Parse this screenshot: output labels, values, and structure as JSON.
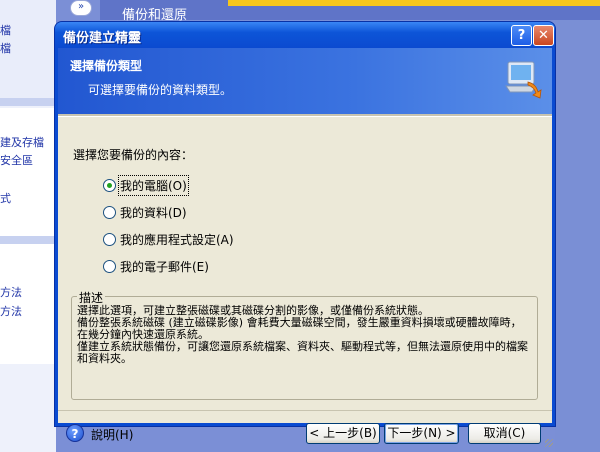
{
  "background": {
    "left_pane_items": [
      "檔",
      "檔",
      "建及存檔",
      "安全區",
      "式",
      "方法",
      "方法"
    ],
    "collapse_icon": "double-chevron-up",
    "title_fragment": "備份和還原"
  },
  "dialog": {
    "title": "備份建立精靈",
    "help_button": "?",
    "close_button": "✕",
    "header": {
      "title": "選擇備份類型",
      "subtitle": "可選擇要備份的資料類型。"
    },
    "prompt": "選擇您要備份的內容：",
    "options": [
      {
        "label": "我的電腦(O)",
        "selected": true
      },
      {
        "label": "我的資料(D)",
        "selected": false
      },
      {
        "label": "我的應用程式設定(A)",
        "selected": false
      },
      {
        "label": "我的電子郵件(E)",
        "selected": false
      }
    ],
    "description": {
      "legend": "描述",
      "lines": [
        "選擇此選項，可建立整張磁碟或其磁碟分割的影像，或僅備份系統狀態。",
        "備份整張系統磁碟 (建立磁碟影像) 會耗費大量磁碟空間，發生嚴重資料損壞或硬體故障時，",
        "在幾分鐘內快速還原系統。",
        "僅建立系統狀態備份，可讓您還原系統檔案、資料夾、驅動程式等，但無法還原使用中的檔案",
        "和資料夾。"
      ]
    },
    "footer": {
      "help_label": "說明(H)",
      "back_button": "< 上一步(B)",
      "next_button": "下一步(N) >",
      "cancel_button": "取消(C)"
    }
  }
}
